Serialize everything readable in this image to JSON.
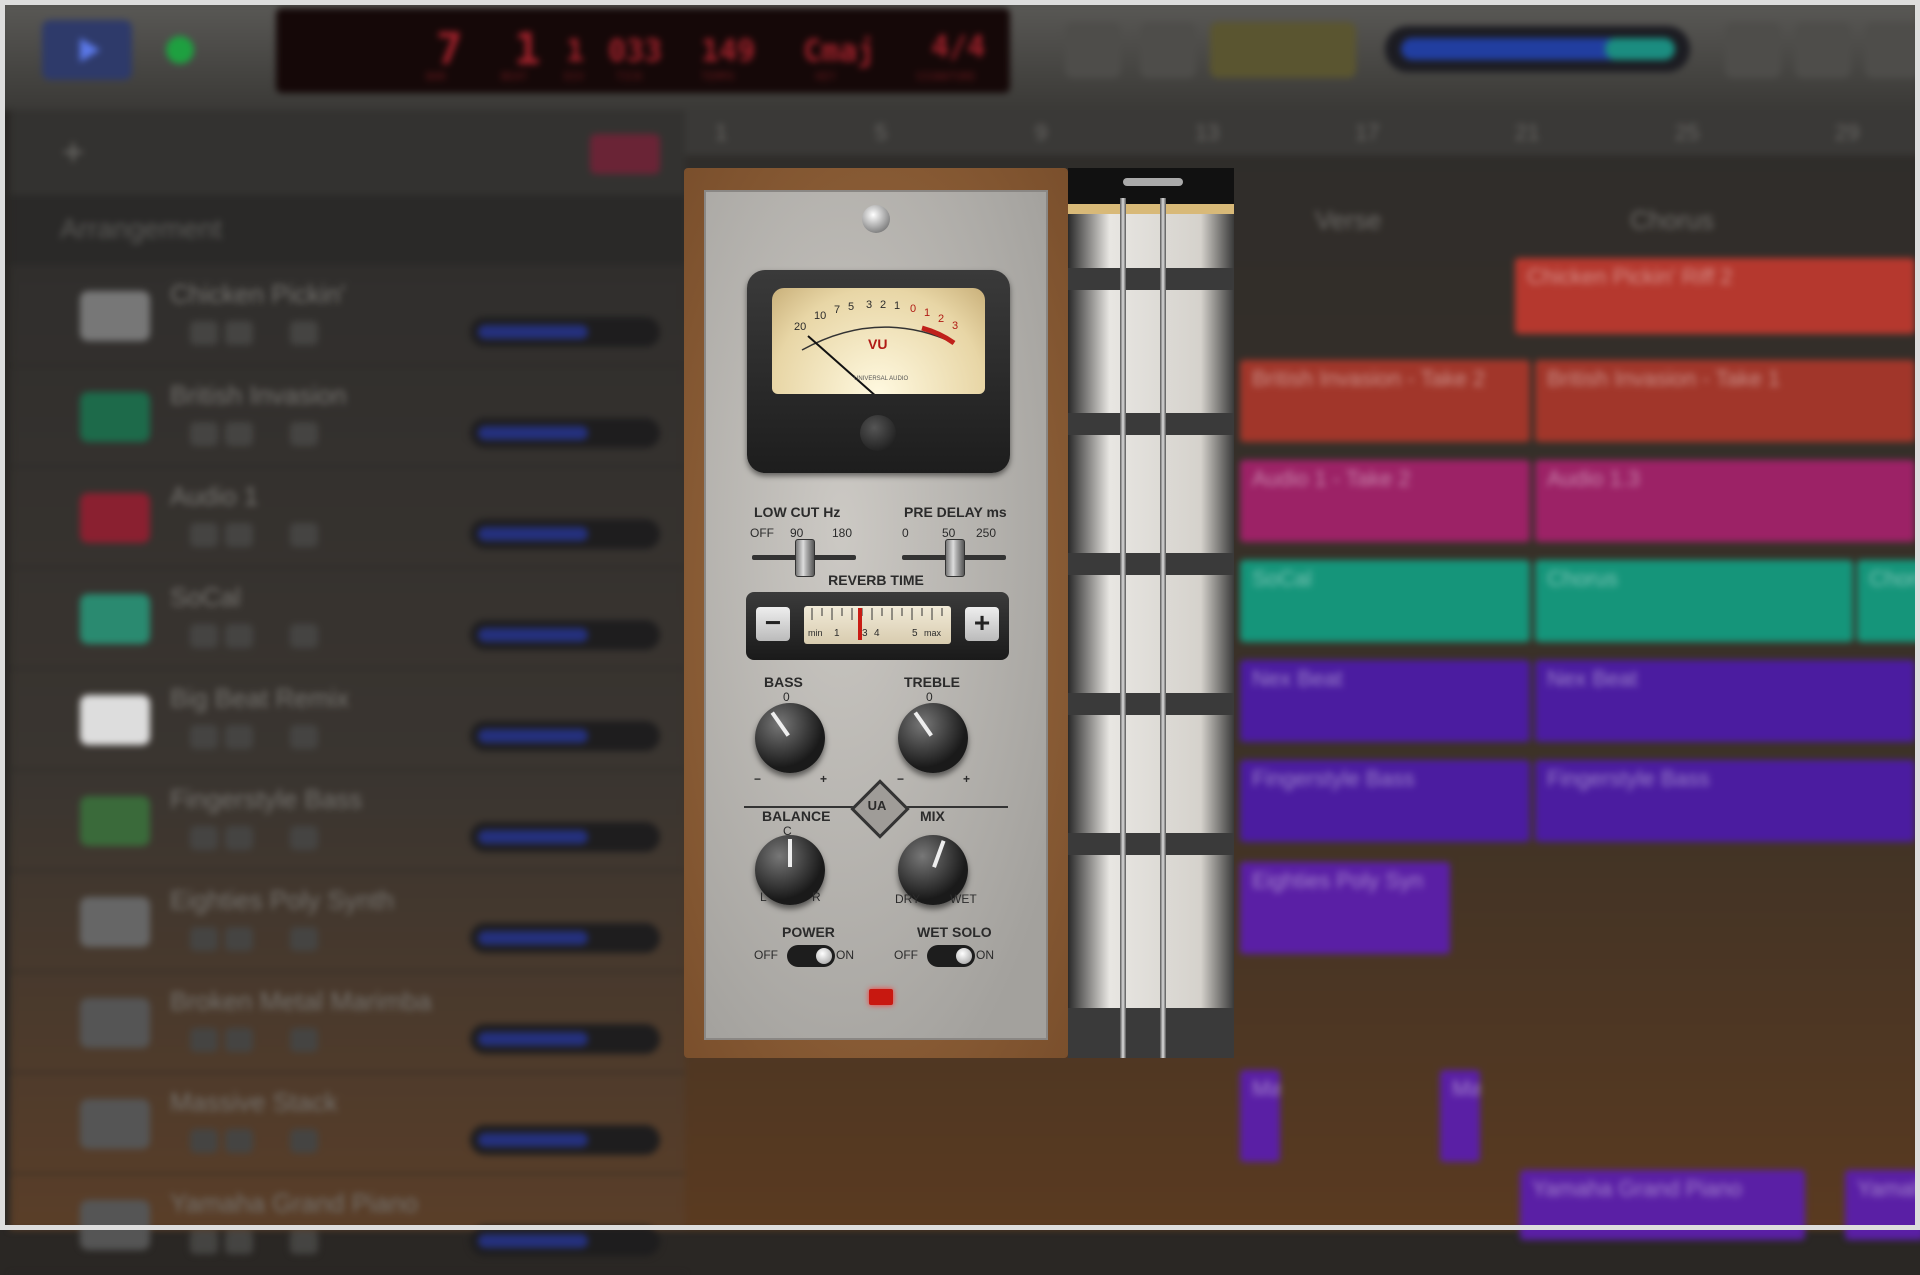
{
  "daw": {
    "lcd": {
      "values": [
        "7",
        "1",
        "1",
        "033",
        "149",
        "Cmaj",
        "4/4"
      ],
      "labels": [
        "BAR",
        "BEAT",
        "DIV",
        "TICK",
        "TEMPO",
        "KEY",
        "SIGNATURE"
      ]
    },
    "arrangement_label": "Arrangement",
    "ruler": [
      "1",
      "5",
      "9",
      "13",
      "17",
      "21",
      "25",
      "29"
    ],
    "sections": [
      "Verse",
      "Chorus"
    ],
    "tracks": [
      {
        "name": "Chicken Pickin'",
        "icon_color": "#777"
      },
      {
        "name": "British Invasion",
        "icon_color": "#1d6a4a"
      },
      {
        "name": "Audio 1",
        "icon_color": "#8a2030"
      },
      {
        "name": "SoCal",
        "icon_color": "#2a8a70"
      },
      {
        "name": "Big Beat Remix",
        "icon_color": "#ddd"
      },
      {
        "name": "Fingerstyle Bass",
        "icon_color": "#3a6a3a"
      },
      {
        "name": "Eighties Poly Synth",
        "icon_color": "#666"
      },
      {
        "name": "Broken Metal Marimba",
        "icon_color": "#555"
      },
      {
        "name": "Massive Stack",
        "icon_color": "#555"
      },
      {
        "name": "Yamaha Grand Piano",
        "icon_color": "#555"
      }
    ],
    "regions": [
      {
        "label": "Chicken Pickin' Riff 2",
        "color": "#b5382e"
      },
      {
        "label": "British Invasion - Take 2",
        "color": "#a1362a"
      },
      {
        "label": "British Invasion - Take 1",
        "color": "#a1362a"
      },
      {
        "label": "Audio 1 - Take 2",
        "color": "#9c2266"
      },
      {
        "label": "Audio 1.3",
        "color": "#9c2266"
      },
      {
        "label": "SoCal",
        "color": "#15957a"
      },
      {
        "label": "Chorus",
        "color": "#15957a"
      },
      {
        "label": "Chorus",
        "color": "#15957a"
      },
      {
        "label": "Nex Beat",
        "color": "#4b1ca0"
      },
      {
        "label": "Nex Beat",
        "color": "#4b1ca0"
      },
      {
        "label": "Fingerstyle Bass",
        "color": "#4b1ca0"
      },
      {
        "label": "Fingerstyle Bass",
        "color": "#4b1ca0"
      },
      {
        "label": "Eighties Poly Syn",
        "color": "#5a1fa5"
      },
      {
        "label": "Ma",
        "color": "#5a1fa5"
      },
      {
        "label": "Ma",
        "color": "#5a1fa5"
      },
      {
        "label": "Yamaha Grand Piano",
        "color": "#5a1fa5"
      },
      {
        "label": "Yamaha",
        "color": "#5a1fa5"
      }
    ]
  },
  "plugin": {
    "meter": {
      "scale": [
        "20",
        "10",
        "7",
        "5",
        "3",
        "2",
        "1",
        "0",
        "1",
        "2",
        "3"
      ],
      "vu_label": "VU",
      "maker": "UNIVERSAL AUDIO"
    },
    "low_cut": {
      "title": "LOW CUT Hz",
      "ticks": [
        "OFF",
        "90",
        "180"
      ],
      "value": 0.5
    },
    "pre_delay": {
      "title": "PRE DELAY ms",
      "ticks": [
        "0",
        "50",
        "250"
      ],
      "value": 0.5
    },
    "reverb_time": {
      "title": "REVERB TIME",
      "minus": "−",
      "plus": "+",
      "scale": [
        "min",
        "1",
        "3",
        "4",
        "5",
        "max"
      ],
      "value": 0.38
    },
    "bass": {
      "title": "BASS",
      "center": "0",
      "minus": "−",
      "plus": "+"
    },
    "treble": {
      "title": "TREBLE",
      "center": "0",
      "minus": "−",
      "plus": "+"
    },
    "balance": {
      "title": "BALANCE",
      "center": "C",
      "left": "L",
      "right": "R"
    },
    "mix": {
      "title": "MIX",
      "left": "DRY",
      "right": "WET"
    },
    "power": {
      "title": "POWER",
      "off": "OFF",
      "on": "ON",
      "state": "on"
    },
    "wet_solo": {
      "title": "WET SOLO",
      "off": "OFF",
      "on": "ON",
      "state": "on"
    },
    "logo": "UA"
  }
}
